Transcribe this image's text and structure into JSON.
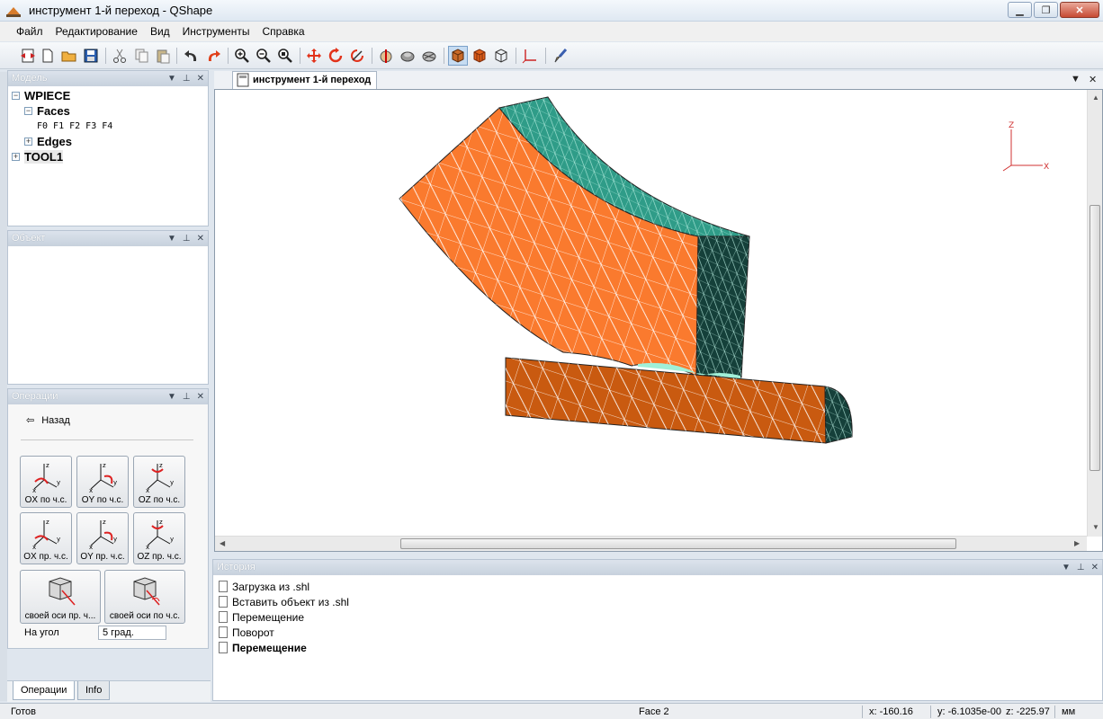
{
  "window": {
    "title": "инструмент 1-й переход - QShape"
  },
  "menu": [
    "Файл",
    "Редактирование",
    "Вид",
    "Инструменты",
    "Справка"
  ],
  "toolbar_icons": [
    "new-doc-icon",
    "new-file-icon",
    "open-folder-icon",
    "save-icon",
    "cut-icon",
    "copy-icon",
    "paste-icon",
    "undo-icon",
    "redo-icon",
    "zoom-in-icon",
    "zoom-out-icon",
    "zoom-fit-icon",
    "move-icon",
    "rotate-icon",
    "rotate-axis-icon",
    "cut-section-icon",
    "sphere-icon",
    "shade-icon",
    "solid-view-icon",
    "faces-view-icon",
    "wireframe-view-icon",
    "axes-icon",
    "brush-icon"
  ],
  "model_panel": {
    "title": "Модель",
    "root": "WPIECE",
    "faces_label": "Faces",
    "faces_items": "F0 F1 F2 F3 F4",
    "edges_label": "Edges",
    "tool": "TOOL1"
  },
  "object_panel": {
    "title": "Объект"
  },
  "operations_panel": {
    "title": "Операции",
    "back": "Назад",
    "buttons": [
      {
        "label": "OX по ч.с."
      },
      {
        "label": "OY по ч.с."
      },
      {
        "label": "OZ по ч.с."
      },
      {
        "label": "OX пр. ч.с."
      },
      {
        "label": "OY пр. ч.с."
      },
      {
        "label": "OZ пр. ч.с."
      }
    ],
    "wide_buttons": [
      {
        "label": "своей оси пр. ч..."
      },
      {
        "label": "своей оси по ч.с."
      }
    ],
    "angle_label": "На угол",
    "angle_value": "5   град."
  },
  "bottom_tabs": [
    "Операции",
    "Info"
  ],
  "document_tab": "инструмент 1-й переход",
  "axes_labels": {
    "z": "Z",
    "x": "X"
  },
  "history_panel": {
    "title": "История",
    "items": [
      "Загрузка из .shl",
      "Вставить объект из .shl",
      "Перемещение",
      "Поворот",
      "Перемещение"
    ]
  },
  "status": {
    "left": "Готов",
    "face": "Face 2",
    "x": "x: -160.16",
    "y": "y: -6.1035e-00",
    "z": "z: -225.97",
    "units": "мм"
  },
  "colors": {
    "orange_face": "#fa7a2e",
    "teal_face": "#2f9c88",
    "dark_teal": "#15403a",
    "bar_face": "#c95a10",
    "mesh": "#ffffff"
  }
}
